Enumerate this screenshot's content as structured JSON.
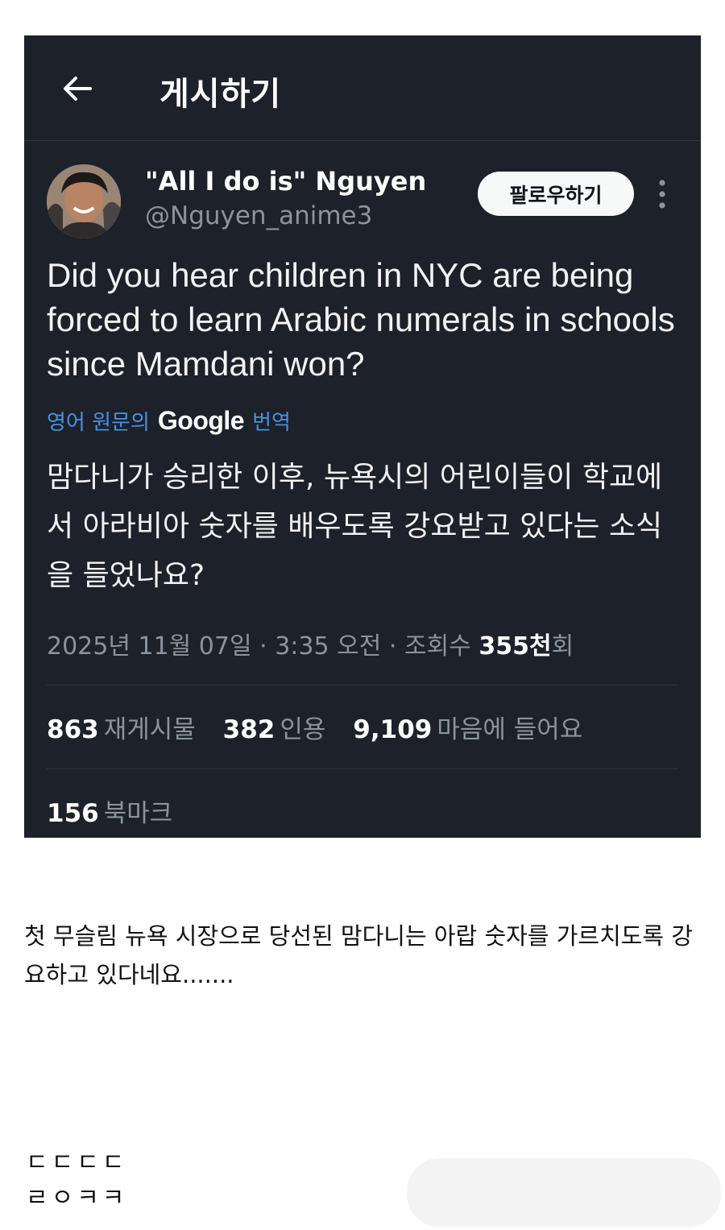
{
  "header": {
    "title": "게시하기"
  },
  "author": {
    "display_name": "\"All I do is\" Nguyen",
    "handle": "@Nguyen_anime3",
    "follow_label": "팔로우하기"
  },
  "tweet": {
    "text": "Did you hear children in NYC are being forced to learn Arabic numerals in schools since Mamdani won?",
    "translate_pre": "영어 원문의",
    "translate_brand": "Google",
    "translate_post": "번역",
    "translated_text": "맘다니가 승리한 이후, 뉴욕시의 어린이들이 학교에서 아라비아 숫자를 배우도록 강요받고 있다는 소식을 들었나요?"
  },
  "meta": {
    "date": "2025년 11월 07일",
    "time": "3:35 오전",
    "views_label": "조회수",
    "views_value": "355천",
    "views_suffix": "회",
    "separator": "·"
  },
  "stats": {
    "reposts_num": "863",
    "reposts_label": "재게시물",
    "quotes_num": "382",
    "quotes_label": "인용",
    "likes_num": "9,109",
    "likes_label": "마음에 들어요",
    "bookmarks_num": "156",
    "bookmarks_label": "북마크"
  },
  "post_body": {
    "caption": "첫 무슬림 뉴욕 시장으로 당선된 맘다니는 아랍 숫자를 가르치도록 강요하고 있다네요.......",
    "reply_line_1": "ㄷㄷㄷㄷ",
    "reply_line_2": "ㄹㅇㅋㅋ"
  },
  "colors": {
    "card_bg": "#1c212a",
    "accent_link": "#4a90e2",
    "muted": "#8b949e"
  },
  "icons": [
    "arrow-left-icon",
    "more-vertical-icon",
    "avatar"
  ]
}
